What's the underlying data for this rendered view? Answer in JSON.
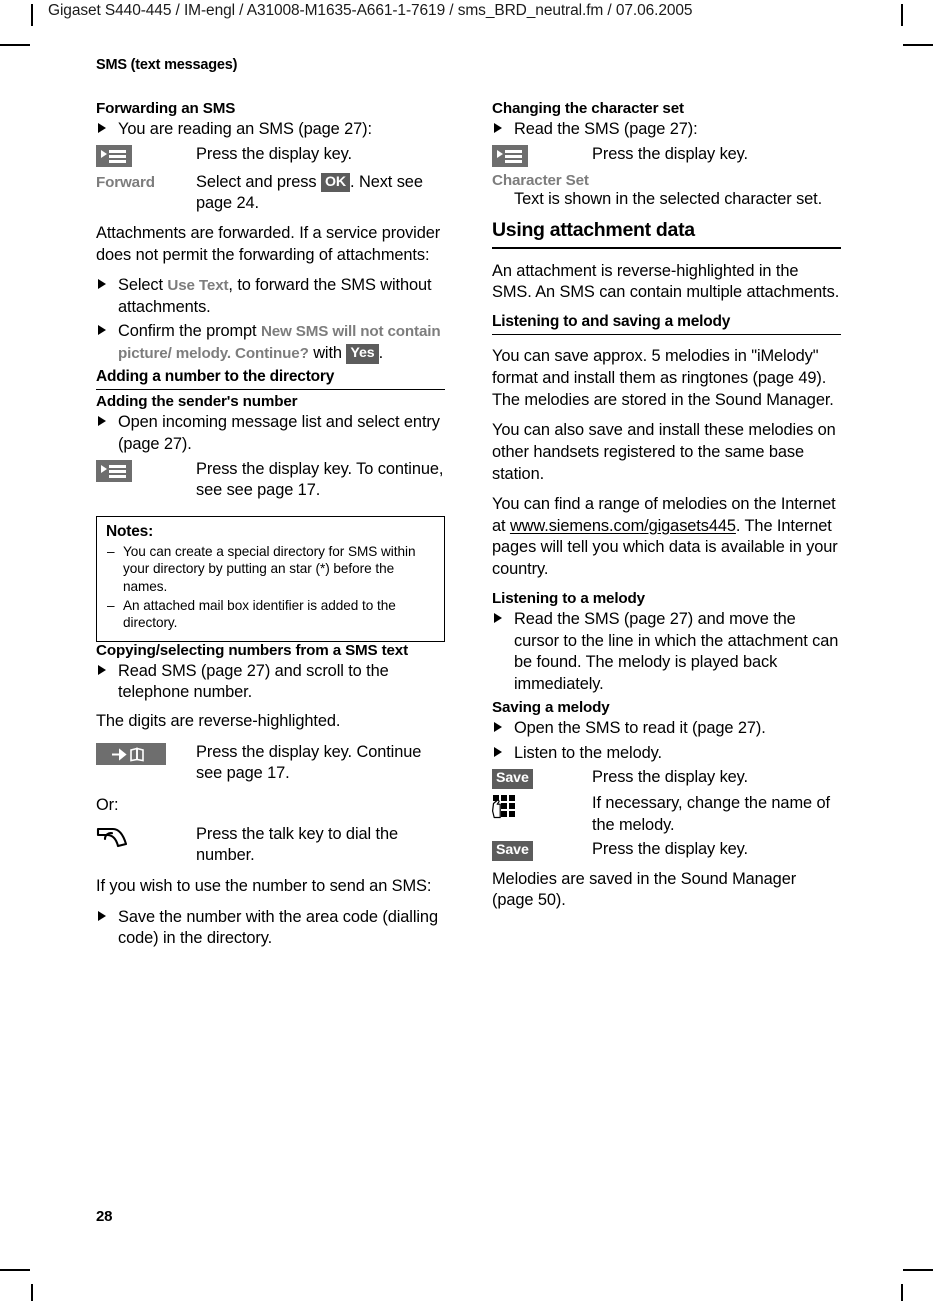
{
  "running_head": "Gigaset S440-445 / IM-engl / A31008-M1635-A661-1-7619 / sms_BRD_neutral.fm / 07.06.2005",
  "chapter_label": "SMS (text messages)",
  "page_number": "28",
  "colors": {
    "badge_background": "#5c5c5c",
    "icon_background": "#6e6e6e",
    "ui_text": "#7d7d7d",
    "rule": "#000000",
    "page_background": "#ffffff"
  },
  "left_column": {
    "forwarding": {
      "heading": "Forwarding an SMS",
      "bullet_1": "You are reading an SMS (page 27):",
      "row_displaykey": {
        "key_icon": "display-key-icon",
        "description": "Press the display key."
      },
      "row_forward": {
        "key_label": "Forward",
        "desc_part_1": "Select and press ",
        "badge": "OK",
        "desc_part_2": ". Next see page 24."
      },
      "paragraph": "Attachments are forwarded. If a service provider does not permit the forwarding of attachments:",
      "bullet_2_part_1": "Select ",
      "bullet_2_ui": "Use Text",
      "bullet_2_part_2": ", to forward the SMS without attachments.",
      "bullet_3_part_1": "Confirm the prompt ",
      "bullet_3_ui": "New SMS will not contain picture/ melody. Continue?",
      "bullet_3_part_2": " with ",
      "bullet_3_badge": "Yes",
      "bullet_3_part_3": "."
    },
    "adding_number": {
      "heading": "Adding a number to the directory",
      "sub_heading": "Adding the sender's number",
      "bullet_1": "Open incoming message list and select entry (page 27).",
      "row_displaykey": {
        "key_icon": "display-key-icon",
        "description": "Press the display key. To continue, see see page 17."
      }
    },
    "notes": {
      "title": "Notes:",
      "items": [
        "You can create a special directory for SMS within your directory by putting an star (*) before the names.",
        "An attached mail box identifier is added to the directory."
      ]
    },
    "copying": {
      "heading": "Copying/selecting numbers from a SMS text",
      "bullet_1": "Read SMS (page 27) and scroll to the telephone number.",
      "paragraph_1": "The digits are reverse-highlighted.",
      "row_dirkey": {
        "key_icon": "directory-key-icon",
        "description": "Press the display key. Continue see page 17."
      },
      "or_label": "Or:",
      "row_talkkey": {
        "key_icon": "talk-key-icon",
        "description": "Press the talk key to dial the number."
      },
      "paragraph_2": "If you wish to use the number to send an SMS:",
      "bullet_2": "Save the number with the area code (dialling code) in the directory."
    }
  },
  "right_column": {
    "character_set": {
      "heading": "Changing the character set",
      "bullet_1": "Read the SMS (page 27):",
      "row_displaykey": {
        "key_icon": "display-key-icon",
        "description": "Press the display key."
      },
      "ui_label": "Character Set",
      "description": "Text is shown in the selected character set."
    },
    "attachment_data": {
      "heading": "Using attachment data",
      "paragraph": "An attachment is reverse-highlighted in the SMS. An SMS can contain multiple attachments."
    },
    "listening_saving": {
      "heading": "Listening to and saving a melody",
      "paragraph_1": "You can save approx. 5 melodies in \"iMelody\" format and install them as ringtones (page 49). The melodies are stored in the Sound Manager.",
      "paragraph_2": "You can also save and install these melodies on other handsets registered to the same base station.",
      "paragraph_3_part_1": "You can find a range of melodies on the Internet at ",
      "paragraph_3_link": "www.siemens.com/gigasets445",
      "paragraph_3_part_2": ". The Internet pages will tell you which data is available in your country."
    },
    "listening_melody": {
      "heading": "Listening to a melody",
      "bullet_1": "Read the SMS (page 27) and move the cursor to the line in which the attachment can be found. The melody is played back immediately."
    },
    "saving_melody": {
      "heading": "Saving a melody",
      "bullet_1": "Open the SMS to read it (page 27).",
      "bullet_2": "Listen to the melody.",
      "row_save_1": {
        "badge": "Save",
        "description": "Press the display key."
      },
      "row_keypad": {
        "key_icon": "keypad-icon",
        "description": "If necessary, change the name of the melody."
      },
      "row_save_2": {
        "badge": "Save",
        "description": "Press the display key."
      },
      "paragraph": "Melodies are saved in the Sound Manager (page 50)."
    }
  }
}
